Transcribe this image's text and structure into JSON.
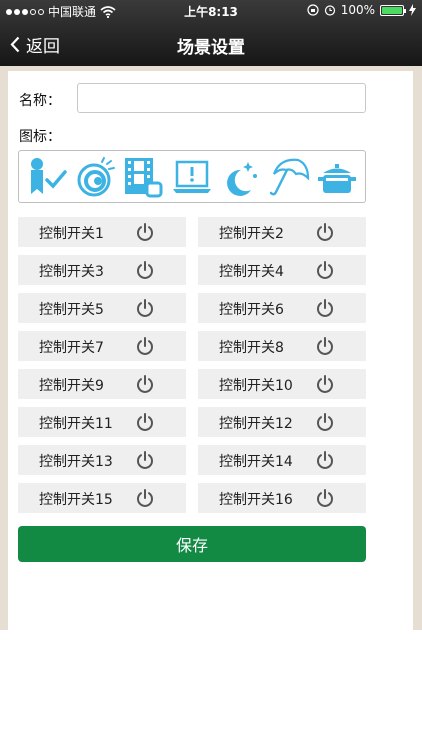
{
  "status_bar": {
    "carrier": "中国联通",
    "time": "上午8:13",
    "battery_percent": "100%",
    "battery_level": 1.0
  },
  "nav": {
    "back_label": "返回",
    "title": "场景设置"
  },
  "form": {
    "name_label": "名称：",
    "name_value": "",
    "icon_label": "图标："
  },
  "scene_icons": [
    {
      "icon": "ribbon-check-icon"
    },
    {
      "icon": "eye-icon"
    },
    {
      "icon": "film-icon"
    },
    {
      "icon": "laptop-alert-icon"
    },
    {
      "icon": "moon-stars-icon"
    },
    {
      "icon": "umbrella-icon"
    },
    {
      "icon": "pot-icon"
    }
  ],
  "switches": [
    {
      "label": "控制开关1"
    },
    {
      "label": "控制开关2"
    },
    {
      "label": "控制开关3"
    },
    {
      "label": "控制开关4"
    },
    {
      "label": "控制开关5"
    },
    {
      "label": "控制开关6"
    },
    {
      "label": "控制开关7"
    },
    {
      "label": "控制开关8"
    },
    {
      "label": "控制开关9"
    },
    {
      "label": "控制开关10"
    },
    {
      "label": "控制开关11"
    },
    {
      "label": "控制开关12"
    },
    {
      "label": "控制开关13"
    },
    {
      "label": "控制开关14"
    },
    {
      "label": "控制开关15"
    },
    {
      "label": "控制开关16"
    }
  ],
  "save_label": "保存",
  "colors": {
    "accent_green": "#128a44",
    "icon_blue": "#3db3e3",
    "frame_beige": "#e6ded3",
    "cell_gray": "#efefef"
  }
}
